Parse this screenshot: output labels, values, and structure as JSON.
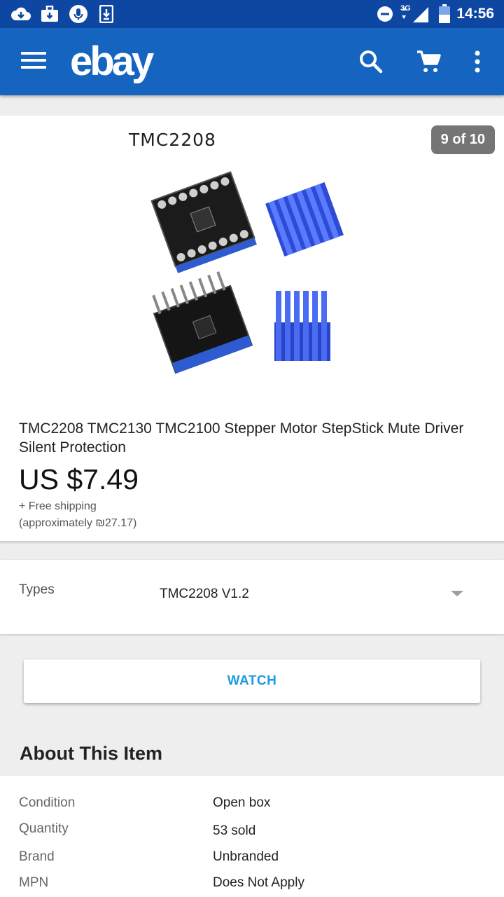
{
  "status_bar": {
    "time": "14:56",
    "network": "3G",
    "battery": "47",
    "icons": [
      "download-cloud-icon",
      "lock-download-icon",
      "microphone-icon",
      "download-icon",
      "do-not-disturb-icon",
      "signal-icon",
      "battery-icon"
    ]
  },
  "app_bar": {
    "logo": "ebay",
    "icons": [
      "menu-icon",
      "search-icon",
      "cart-icon",
      "more-vert-icon"
    ]
  },
  "gallery": {
    "caption": "TMC2208",
    "counter": "9 of 10"
  },
  "product": {
    "title": "TMC2208 TMC2130 TMC2100 Stepper Motor StepStick Mute Driver Silent Protection",
    "price": "US $7.49",
    "shipping": "+ Free shipping",
    "approx": "(approximately ₪27.17)"
  },
  "variation": {
    "label": "Types",
    "value": "TMC2208 V1.2"
  },
  "actions": {
    "watch": "WATCH"
  },
  "about": {
    "title": "About This Item",
    "specs": [
      {
        "key": "Condition",
        "value": "Open box"
      },
      {
        "key": "Quantity",
        "value": "53 sold"
      },
      {
        "key": "Brand",
        "value": "Unbranded"
      },
      {
        "key": "MPN",
        "value": "Does Not Apply"
      }
    ]
  },
  "colors": {
    "status_bar": "#0d47a1",
    "app_bar": "#1565c0",
    "link": "#1e9be0",
    "heatsink": "#3b5bdb"
  }
}
